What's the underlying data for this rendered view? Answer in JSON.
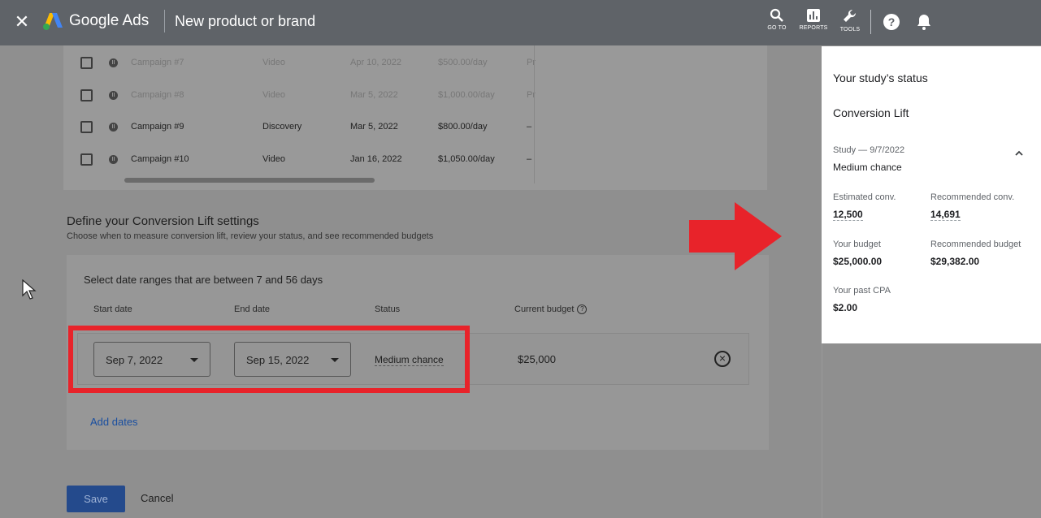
{
  "topbar": {
    "brand": "Google Ads",
    "page_title": "New product or brand",
    "tools": [
      {
        "icon": "search-icon",
        "label": "GO TO"
      },
      {
        "icon": "reports-icon",
        "label": "REPORTS"
      },
      {
        "icon": "wrench-icon",
        "label": "TOOLS"
      }
    ]
  },
  "campaign_table": {
    "rows": [
      {
        "name": "Campaign #7",
        "type": "Video",
        "date": "Apr 10, 2022",
        "budget": "$500.00/day",
        "extra": "Pr",
        "faded": true
      },
      {
        "name": "Campaign #8",
        "type": "Video",
        "date": "Mar 5, 2022",
        "budget": "$1,000.00/day",
        "extra": "Pr",
        "faded": true
      },
      {
        "name": "Campaign #9",
        "type": "Discovery",
        "date": "Mar 5, 2022",
        "budget": "$800.00/day",
        "extra": "–",
        "faded": false
      },
      {
        "name": "Campaign #10",
        "type": "Video",
        "date": "Jan 16, 2022",
        "budget": "$1,050.00/day",
        "extra": "–",
        "faded": false
      }
    ]
  },
  "settings": {
    "title": "Define your Conversion Lift settings",
    "subtitle": "Choose when to measure conversion lift, review your status, and see recommended budgets",
    "hint": "Select date ranges that are between 7 and 56 days",
    "headers": {
      "start": "Start date",
      "end": "End date",
      "status": "Status",
      "budget": "Current budget"
    },
    "row": {
      "start": "Sep 7, 2022",
      "end": "Sep 15, 2022",
      "status": "Medium chance",
      "budget": "$25,000"
    },
    "add_dates": "Add dates"
  },
  "actions": {
    "save": "Save",
    "cancel": "Cancel"
  },
  "panel": {
    "title": "Your study’s status",
    "subtitle": "Conversion Lift",
    "study": "Study — 9/7/2022",
    "chance": "Medium chance",
    "estimated_conv_label": "Estimated conv.",
    "estimated_conv": "12,500",
    "recommended_conv_label": "Recommended conv.",
    "recommended_conv": "14,691",
    "your_budget_label": "Your budget",
    "your_budget": "$25,000.00",
    "recommended_budget_label": "Recommended budget",
    "recommended_budget": "$29,382.00",
    "past_cpa_label": "Your past CPA",
    "past_cpa": "$2.00"
  },
  "colors": {
    "highlight": "#e8232a",
    "link": "#1a4fa0",
    "topbar": "#5f6368"
  }
}
